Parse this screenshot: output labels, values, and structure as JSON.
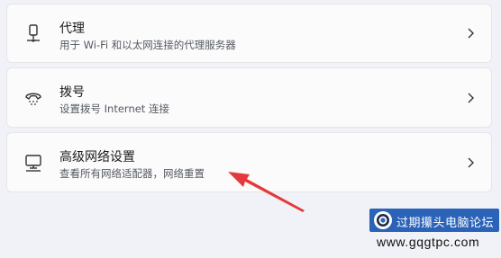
{
  "settings_items": [
    {
      "id": "proxy",
      "icon": "proxy-icon",
      "title": "代理",
      "description": "用于 Wi-Fi 和以太网连接的代理服务器"
    },
    {
      "id": "dialup",
      "icon": "dialup-icon",
      "title": "拨号",
      "description": "设置拨号 Internet 连接"
    },
    {
      "id": "advanced",
      "icon": "computer-network-icon",
      "title": "高级网络设置",
      "description": "查看所有网络适配器，网络重置"
    }
  ],
  "annotation": {
    "arrow_color": "#e5393b"
  },
  "watermark": {
    "name": "过期攥头电脑论坛",
    "url": "www.gqgtpc.com",
    "badge_color": "#2a63b8"
  },
  "colors": {
    "background": "#f0f2f7",
    "card": "#fbfbfc",
    "title_text": "#1b1b1b",
    "desc_text": "#555a60"
  }
}
